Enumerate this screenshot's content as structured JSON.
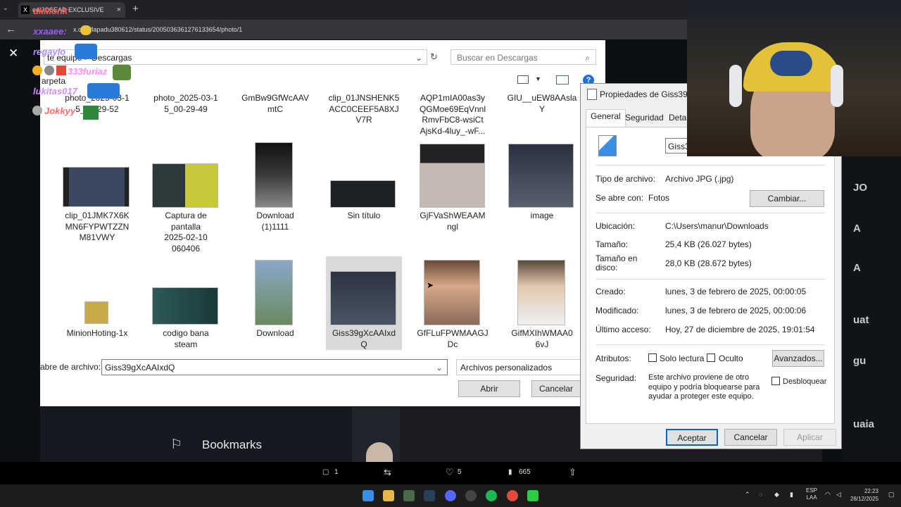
{
  "browser": {
    "tab_title": "ed JOSEAD EXCLUSIVE",
    "tab_close": "×",
    "new_tab": "+",
    "url": "x.com/lapadu380612/status/2005036361276133654/photo/1",
    "tab_logo": "X"
  },
  "chat": [
    {
      "user": "dkMonk",
      "color": "#ff5a5a"
    },
    {
      "user": "xxaaee:",
      "color": "#9b59ff"
    },
    {
      "user": "regaylo",
      "color": "#b48cff"
    },
    {
      "user": "333furiaz",
      "color": "#ff8cff"
    },
    {
      "user": "lukitas017",
      "color": "#d28cff"
    },
    {
      "user": "Jokkyy",
      "color": "#ff6b6b"
    }
  ],
  "file_dialog": {
    "path": "te equipo > Descargas",
    "search_placeholder": "Buscar en Descargas",
    "partial_label": "arpeta",
    "rows": [
      [
        {
          "name": "photo_2025-03-1\n5_00-29-52"
        },
        {
          "name": "photo_2025-03-1\n5_00-29-49"
        },
        {
          "name": "GmBw9GfWcAAV\nmtC"
        },
        {
          "name": "clip_01JNSHENK5\nACC0CEEF5A8XJ\nV7R"
        },
        {
          "name": "AQP1mIA00as3y\nQGMoe69EqVnnl\nRmvFbC8-wsiCt\nAjsKd-4luy_-wF..."
        },
        {
          "name": "GIU__uEW8AAsla\nY"
        }
      ],
      [
        {
          "name": "clip_01JMK7X6K\nMN6FYPWTZZN\nM81VWY"
        },
        {
          "name": "Captura de\npantalla\n2025-02-10\n060406"
        },
        {
          "name": "Download\n(1)1111"
        },
        {
          "name": "Sin título"
        },
        {
          "name": "GjFVaShWEAAM\nngl"
        },
        {
          "name": "image"
        }
      ],
      [
        {
          "name": "MinionHoting-1x"
        },
        {
          "name": "codigo bana\nsteam"
        },
        {
          "name": "Download"
        },
        {
          "name": "Giss39gXcAAIxd\nQ"
        },
        {
          "name": "GfFLuFPWMAAGJ\nDc"
        },
        {
          "name": "GifMXIhWMAA0\n6vJ"
        }
      ]
    ],
    "filename_label": "abre de archivo:",
    "filename_value": "Giss39gXcAAIxdQ",
    "filetype": "Archivos personalizados",
    "open_button": "Abrir",
    "cancel_button": "Cancelar"
  },
  "properties": {
    "title": "Propiedades de Giss39",
    "tabs": [
      "General",
      "Seguridad",
      "Detal"
    ],
    "file_name": "Giss3",
    "rows": {
      "tipo_label": "Tipo de archivo:",
      "tipo_value": "Archivo JPG (.jpg)",
      "abre_label": "Se abre con:",
      "abre_value": "Fotos",
      "cambiar": "Cambiar...",
      "ubic_label": "Ubicación:",
      "ubic_value": "C:\\Users\\manur\\Downloads",
      "tam_label": "Tamaño:",
      "tam_value": "25,4 KB (26.027 bytes)",
      "tamd_label": "Tamaño en\ndisco:",
      "tamd_value": "28,0 KB (28.672 bytes)",
      "creado_label": "Creado:",
      "creado_value": "lunes, 3 de febrero de 2025, 00:00:05",
      "mod_label": "Modificado:",
      "mod_value": "lunes, 3 de febrero de 2025, 00:00:06",
      "acc_label": "Último acceso:",
      "acc_value": "Hoy, 27 de diciembre de 2025, 19:01:54",
      "attr_label": "Atributos:",
      "solo_lectura": "Solo lectura",
      "oculto": "Oculto",
      "avanzados": "Avanzados...",
      "seg_label": "Seguridad:",
      "seg_text": "Este archivo proviene de otro equipo y podría bloquearse para ayudar a proteger este equipo.",
      "desbloquear": "Desbloquear"
    },
    "buttons": {
      "ok": "Aceptar",
      "cancel": "Cancelar",
      "apply": "Aplicar"
    }
  },
  "twitter": {
    "bookmarks": "Bookmarks",
    "reply_count": "1",
    "like_count": "5",
    "view_count": "665",
    "right_letters": [
      "JO",
      "A",
      "A",
      "uat",
      "gu",
      "uaia"
    ]
  },
  "taskbar": {
    "lang_top": "ESP",
    "lang_bottom": "LAA",
    "time": "22:23",
    "date": "28/12/2025"
  }
}
